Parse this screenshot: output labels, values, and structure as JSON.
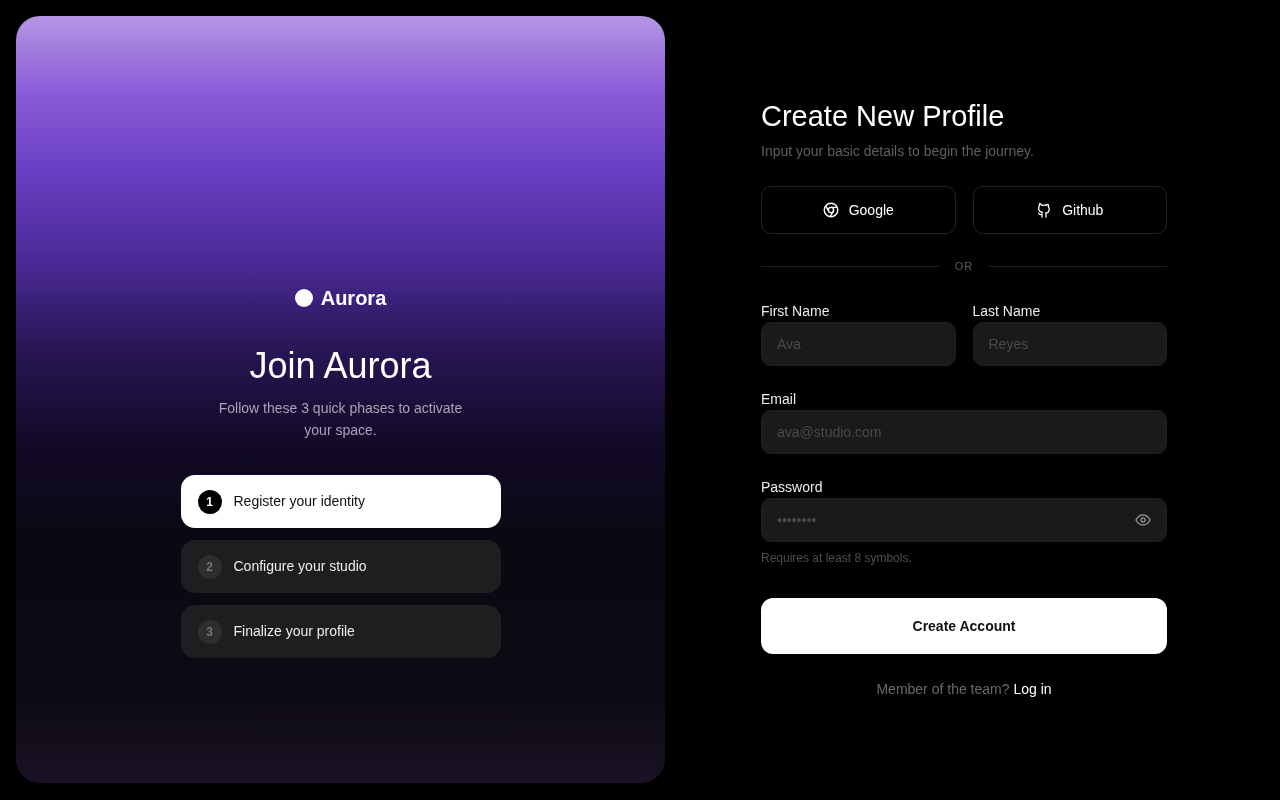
{
  "hero": {
    "brand": "Aurora",
    "title": "Join Aurora",
    "subtitle": "Follow these 3 quick phases to activate your space.",
    "steps": [
      {
        "number": "1",
        "label": "Register your identity",
        "selected": true
      },
      {
        "number": "2",
        "label": "Configure your studio",
        "selected": false
      },
      {
        "number": "3",
        "label": "Finalize your profile",
        "selected": false
      }
    ]
  },
  "form": {
    "title": "Create New Profile",
    "subtitle": "Input your basic details to begin the journey.",
    "social_buttons": [
      {
        "label": "Google",
        "kind": "google"
      },
      {
        "label": "Github",
        "kind": "github"
      }
    ],
    "divider": "OR",
    "field_rows": [
      [
        {
          "label": "First Name",
          "placeholder": "Ava",
          "kind": "text"
        },
        {
          "label": "Last Name",
          "placeholder": "Reyes",
          "kind": "text"
        }
      ],
      [
        {
          "label": "Email",
          "placeholder": "ava@studio.com",
          "kind": "email"
        }
      ],
      [
        {
          "label": "Password",
          "placeholder": "••••••••",
          "kind": "password",
          "hint": "Requires at least 8 symbols."
        }
      ]
    ],
    "submit": "Create Account",
    "footer": {
      "text": "Member of the team?",
      "link": "Log in"
    }
  }
}
